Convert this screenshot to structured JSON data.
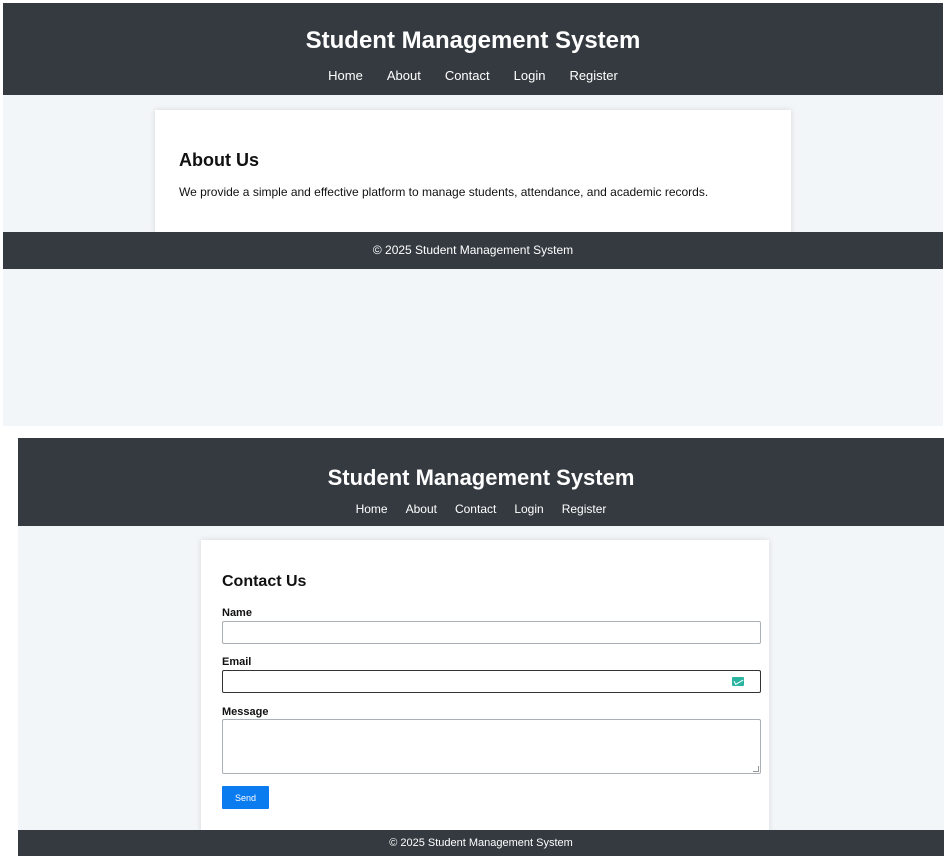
{
  "screens": {
    "about": {
      "header": {
        "title": "Student Management System",
        "nav": [
          "Home",
          "About",
          "Contact",
          "Login",
          "Register"
        ]
      },
      "card": {
        "heading": "About Us",
        "text": "We provide a simple and effective platform to manage students, attendance, and academic records."
      },
      "footer": "© 2025 Student Management System"
    },
    "contact": {
      "header": {
        "title": "Student Management System",
        "nav": [
          "Home",
          "About",
          "Contact",
          "Login",
          "Register"
        ]
      },
      "form": {
        "heading": "Contact Us",
        "name_label": "Name",
        "name_value": "",
        "email_label": "Email",
        "email_value": "",
        "message_label": "Message",
        "message_value": "",
        "send_label": "Send"
      },
      "footer": "© 2025 Student Management System"
    }
  },
  "colors": {
    "header_bg": "#343a40",
    "page_bg": "#f3f6f9",
    "button_bg": "#0a7cf0",
    "email_icon": "#2bb5a0"
  },
  "icons": {
    "email_field_icon": "email-autofill-icon"
  }
}
